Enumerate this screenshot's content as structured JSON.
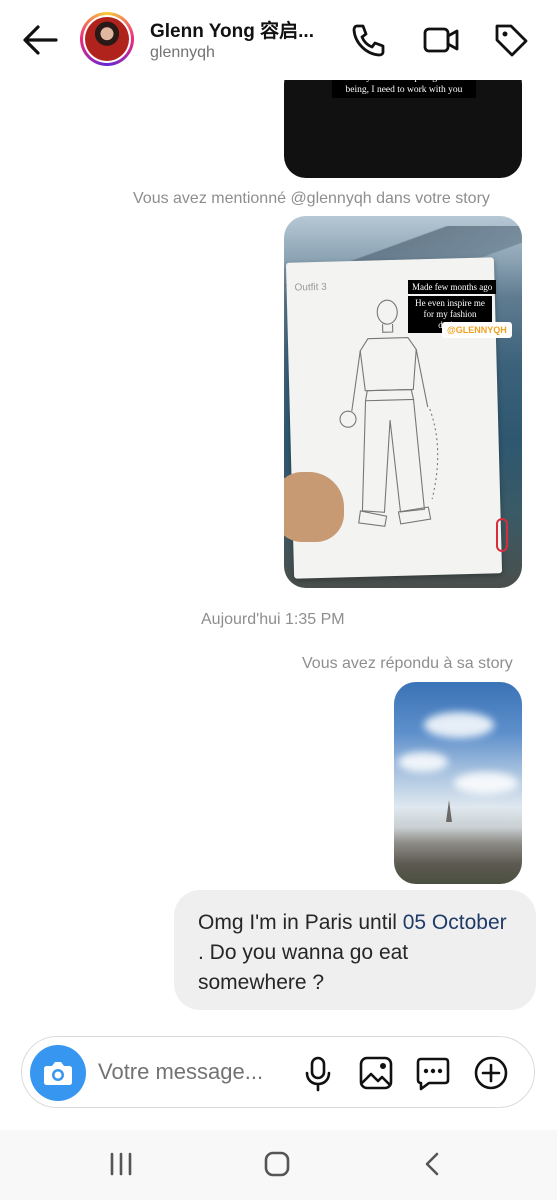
{
  "header": {
    "name": "Glenn Yong 容启...",
    "handle": "glennyqh"
  },
  "stories": {
    "first_caption": "Since you're an inspiring human being, I need to work with you",
    "mention_note": "Vous avez mentionné @glennyqh dans votre story",
    "sketch_labels": {
      "made": "Made few months ago",
      "inspire": "He even inspire me for my fashion design",
      "mention": "@GLENNYQH",
      "paper_title": "Outfit 3"
    },
    "timestamp": "Aujourd'hui 1:35 PM",
    "reply_note": "Vous avez répondu à sa story"
  },
  "message": {
    "before": "Omg I'm in Paris until ",
    "date_link": "05 October",
    "after": " . Do you wanna go eat somewhere ?"
  },
  "composer": {
    "placeholder": "Votre message..."
  },
  "icons": {
    "back": "arrow-left-icon",
    "call": "phone-icon",
    "video": "video-camera-icon",
    "tag": "tag-icon",
    "camera": "camera-icon",
    "mic": "microphone-icon",
    "gallery": "image-icon",
    "sticker": "chat-bubble-icon",
    "add": "plus-circle-icon"
  },
  "colors": {
    "accent": "#3797f0",
    "bubble": "#efefef",
    "link": "#1f3b68",
    "meta": "#8e8e8e"
  }
}
